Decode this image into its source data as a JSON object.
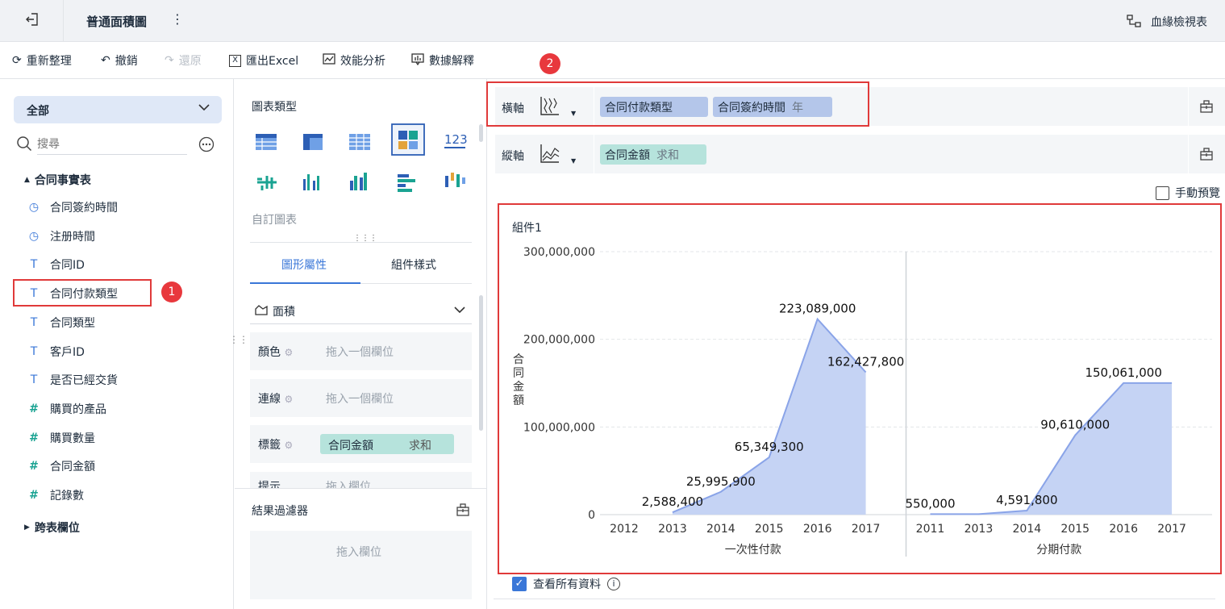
{
  "header": {
    "title": "普通面積圖",
    "lineage_label": "血緣檢視表"
  },
  "toolbar": {
    "refresh": "重新整理",
    "undo": "撤銷",
    "redo": "還原",
    "export_excel": "匯出Excel",
    "performance": "效能分析",
    "explain": "數據解釋"
  },
  "left": {
    "scope": "全部",
    "search_placeholder": "搜尋",
    "table_name": "合同事實表",
    "fields": [
      {
        "name": "合同簽約時間",
        "type": "date"
      },
      {
        "name": "注册時間",
        "type": "date"
      },
      {
        "name": "合同ID",
        "type": "text"
      },
      {
        "name": "合同付款類型",
        "type": "text"
      },
      {
        "name": "合同類型",
        "type": "text"
      },
      {
        "name": "客戶ID",
        "type": "text"
      },
      {
        "name": "是否已經交貨",
        "type": "text"
      },
      {
        "name": "購買的產品",
        "type": "number"
      },
      {
        "name": "購買數量",
        "type": "number"
      },
      {
        "name": "合同金額",
        "type": "number"
      },
      {
        "name": "記錄數",
        "type": "number"
      }
    ],
    "cross_table": "跨表欄位"
  },
  "middle": {
    "chart_type_title": "圖表類型",
    "custom_chart": "自訂圖表",
    "tab_graph": "圖形屬性",
    "tab_style": "組件樣式",
    "mark_type": "面積",
    "props": [
      {
        "label": "顏色",
        "placeholder": "拖入一個欄位"
      },
      {
        "label": "連線",
        "placeholder": "拖入一個欄位"
      },
      {
        "label": "標籤",
        "pill": "合同金額",
        "agg": "求和"
      },
      {
        "label": "提示",
        "placeholder": "拖入欄位"
      }
    ],
    "filter_title": "結果過濾器",
    "filter_placeholder": "拖入欄位"
  },
  "axes": {
    "x_label": "橫軸",
    "x_fields": [
      {
        "name": "合同付款類型",
        "agg": ""
      },
      {
        "name": "合同簽約時間",
        "agg": "年"
      }
    ],
    "y_label": "縱軸",
    "y_fields": [
      {
        "name": "合同金額",
        "agg": "求和"
      }
    ],
    "manual_preview": "手動預覽"
  },
  "annotations": {
    "badge1": "1",
    "badge2": "2"
  },
  "footer": {
    "view_all": "查看所有資料"
  },
  "colors": {
    "accent": "#3a77d8",
    "area_fill": "#c5d3f4",
    "area_line": "#8aa4e8",
    "highlight": "#e03a3a",
    "pill_blue": "#b4c6ea",
    "pill_green": "#b6e3dc"
  },
  "chart_data": {
    "type": "area",
    "title": "組件1",
    "ylabel": "合同金額",
    "ylim": [
      0,
      300000000
    ],
    "yticks": [
      0,
      100000000,
      200000000,
      300000000
    ],
    "ytick_labels": [
      "0",
      "100,000,000",
      "200,000,000",
      "300,000,000"
    ],
    "grid": true,
    "panels": [
      {
        "group": "一次性付款",
        "x": [
          "2012",
          "2013",
          "2014",
          "2015",
          "2016",
          "2017"
        ],
        "values": [
          null,
          2588400,
          25995900,
          65349300,
          223089000,
          162427800
        ],
        "labels": [
          "",
          "2,588,400",
          "25,995,900",
          "65,349,300",
          "223,089,000",
          "162,427,800"
        ]
      },
      {
        "group": "分期付款",
        "x": [
          "2011",
          "2013",
          "2014",
          "2015",
          "2016",
          "2017"
        ],
        "values": [
          550000,
          null,
          4591800,
          90610000,
          150061000,
          150061000
        ],
        "labels": [
          "550,000",
          "",
          "4,591,800",
          "90,610,000",
          "150,061,000",
          ""
        ]
      }
    ]
  }
}
